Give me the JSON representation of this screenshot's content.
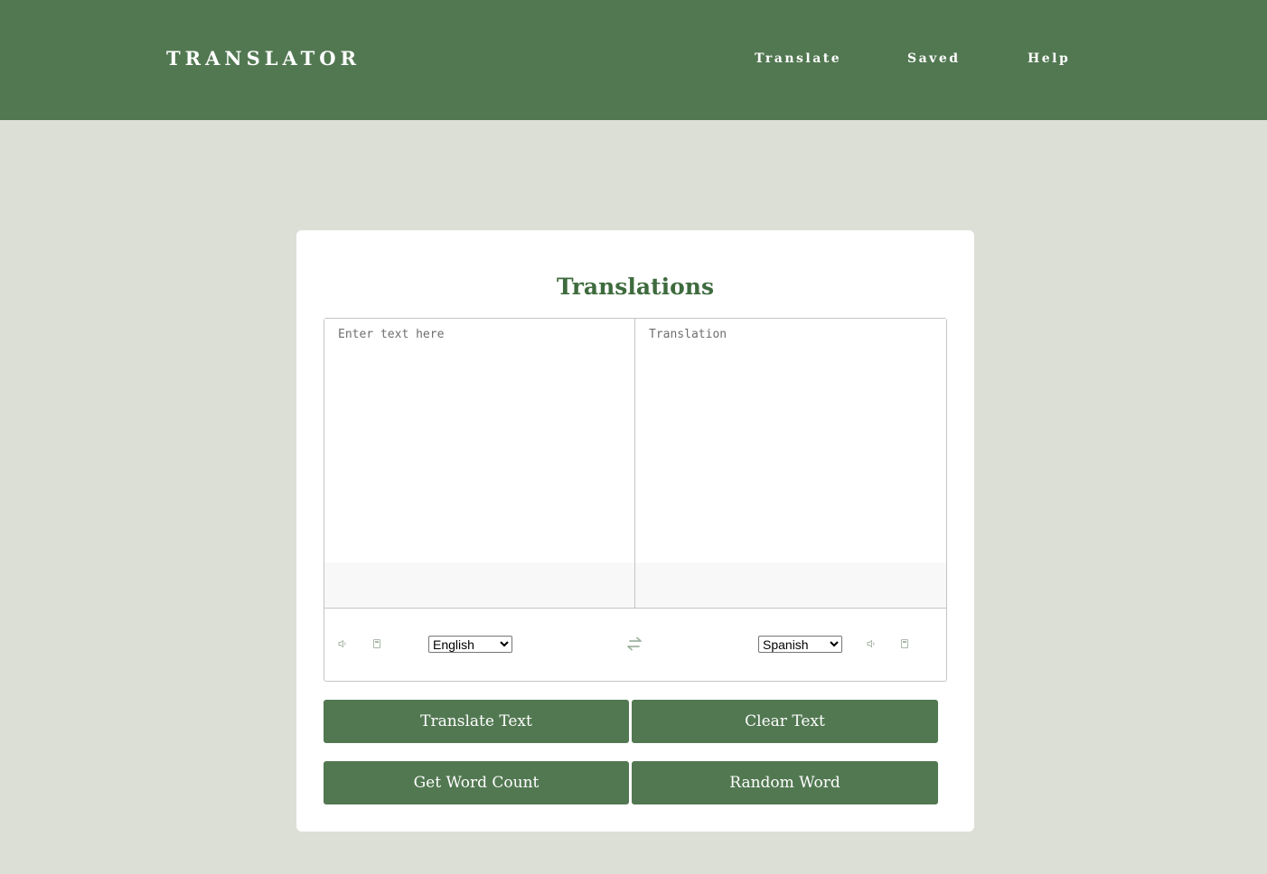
{
  "header": {
    "logo": "TRANSLATOR",
    "nav": [
      "Translate",
      "Saved",
      "Help"
    ]
  },
  "card": {
    "title": "Translations",
    "source": {
      "placeholder": "Enter text here",
      "value": ""
    },
    "target": {
      "placeholder": "Translation",
      "value": ""
    },
    "controls": {
      "from_language": "English",
      "to_language": "Spanish",
      "icons": [
        "speaker-icon",
        "copy-icon",
        "swap-icon",
        "speaker-icon",
        "copy-icon"
      ]
    },
    "buttons": {
      "translate": "Translate Text",
      "clear": "Clear Text",
      "word_count": "Get Word Count",
      "random_word": "Random Word"
    }
  },
  "colors": {
    "header_bg": "#527852",
    "page_bg": "#dcdfd6",
    "title": "#3e6b3e",
    "button_bg": "#527852",
    "icon": "#a9b8a9"
  }
}
